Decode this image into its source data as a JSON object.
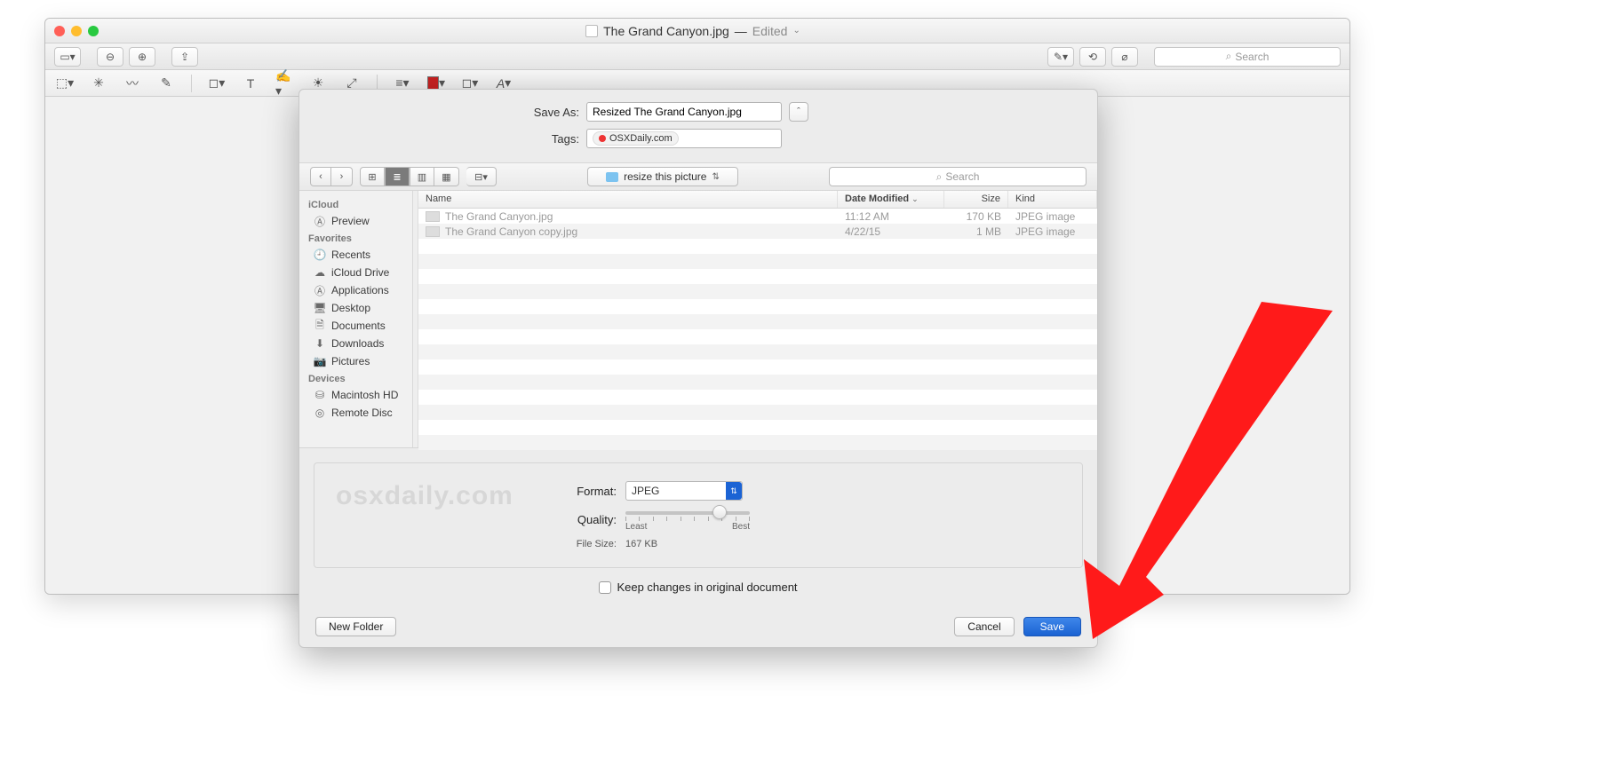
{
  "titlebar": {
    "filename": "The Grand Canyon.jpg",
    "status": "Edited"
  },
  "mainSearch": {
    "placeholder": "Search"
  },
  "saveSheet": {
    "saveAsLabel": "Save As:",
    "saveAsValue": "Resized The Grand Canyon.jpg",
    "tagsLabel": "Tags:",
    "tagValue": "OSXDaily.com",
    "folder": "resize this picture",
    "searchPlaceholder": "Search",
    "columns": {
      "name": "Name",
      "dateModified": "Date Modified",
      "size": "Size",
      "kind": "Kind"
    },
    "files": [
      {
        "name": "The Grand Canyon.jpg",
        "date": "11:12 AM",
        "size": "170 KB",
        "kind": "JPEG image"
      },
      {
        "name": "The Grand Canyon copy.jpg",
        "date": "4/22/15",
        "size": "1 MB",
        "kind": "JPEG image"
      }
    ],
    "sidebar": {
      "sections": [
        {
          "title": "iCloud",
          "items": [
            "Preview"
          ]
        },
        {
          "title": "Favorites",
          "items": [
            "Recents",
            "iCloud Drive",
            "Applications",
            "Desktop",
            "Documents",
            "Downloads",
            "Pictures"
          ]
        },
        {
          "title": "Devices",
          "items": [
            "Macintosh HD",
            "Remote Disc"
          ]
        }
      ]
    },
    "options": {
      "formatLabel": "Format:",
      "formatValue": "JPEG",
      "qualityLabel": "Quality:",
      "qualityLeast": "Least",
      "qualityBest": "Best",
      "fileSizeLabel": "File Size:",
      "fileSizeValue": "167 KB",
      "watermark": "osxdaily.com"
    },
    "keepChanges": "Keep changes in original document",
    "buttons": {
      "newFolder": "New Folder",
      "cancel": "Cancel",
      "save": "Save"
    }
  }
}
